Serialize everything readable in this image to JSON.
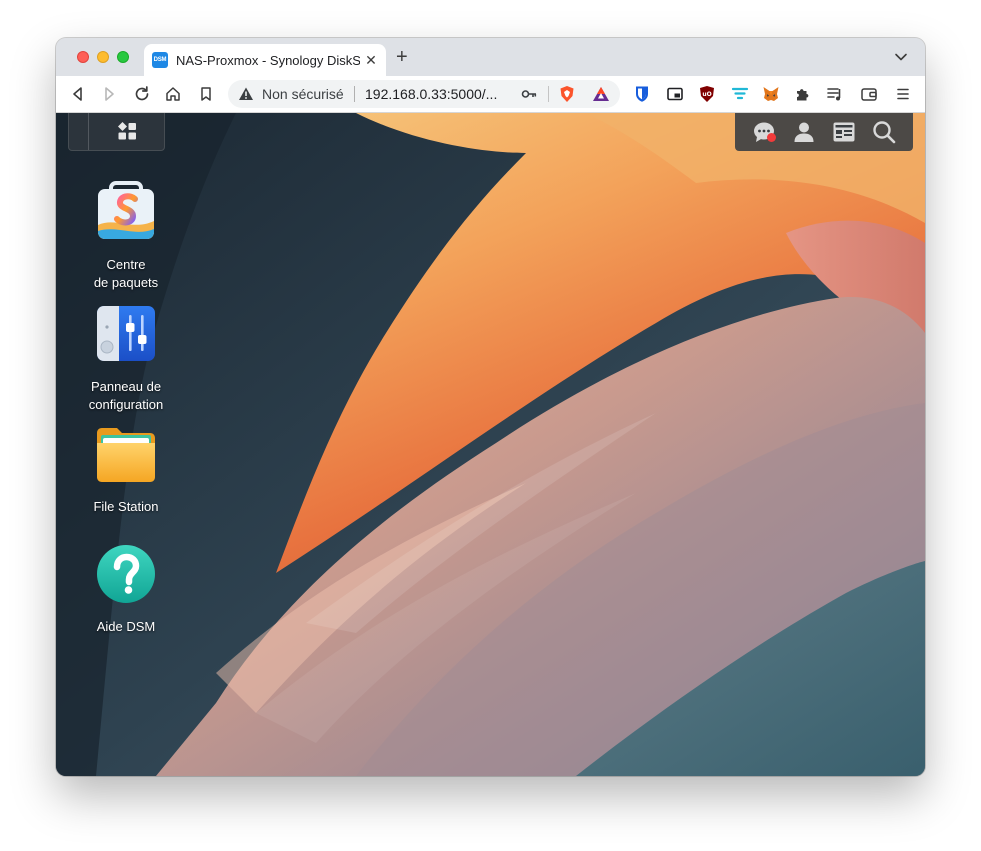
{
  "browser": {
    "tab": {
      "favicon_text": "DSM",
      "title": "NAS-Proxmox - Synology DiskS",
      "close_label": "✕"
    },
    "new_tab_label": "+",
    "omnibox": {
      "security_status": "Non sécurisé",
      "url": "192.168.0.33:5000/..."
    },
    "icons": [
      "back-icon",
      "forward-icon",
      "reload-icon",
      "home-icon",
      "bookmark-icon",
      "warning-icon",
      "key-icon",
      "brave-shields-icon",
      "brave-rewards-icon",
      "bitwarden-icon",
      "picture-in-picture-icon",
      "ublock-origin-icon",
      "filter-icon",
      "metamask-icon",
      "extensions-icon",
      "reading-list-icon",
      "wallet-icon",
      "menu-icon",
      "tab-search-chevron-icon"
    ]
  },
  "dsm": {
    "desktop_apps": [
      {
        "label_line1": "Centre",
        "label_line2": "de paquets",
        "icon": "package-center-icon"
      },
      {
        "label_line1": "Panneau de",
        "label_line2": "configuration",
        "icon": "control-panel-icon"
      },
      {
        "label_line1": "File Station",
        "label_line2": "",
        "icon": "file-station-icon"
      },
      {
        "label_line1": "Aide DSM",
        "label_line2": "",
        "icon": "dsm-help-icon"
      }
    ],
    "taskbar_icons": [
      "main-menu-icon",
      "notifications-icon",
      "user-icon",
      "widgets-icon",
      "search-icon"
    ]
  },
  "colors": {
    "notification_dot": "#f23b3b",
    "favicon_bg": "#1e88e5",
    "help_teal": "#1fb7a6"
  }
}
